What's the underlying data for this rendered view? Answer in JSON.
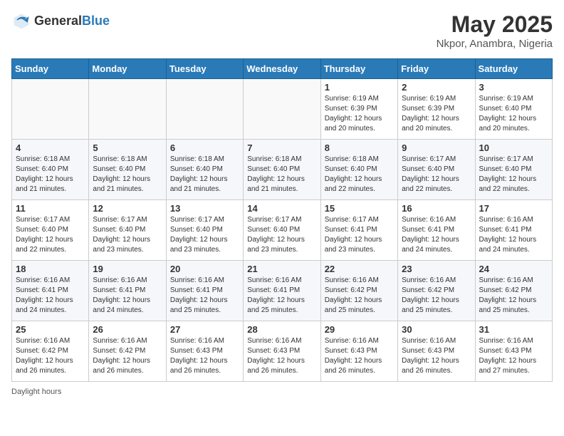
{
  "header": {
    "logo_general": "General",
    "logo_blue": "Blue",
    "title": "May 2025",
    "location": "Nkpor, Anambra, Nigeria"
  },
  "weekdays": [
    "Sunday",
    "Monday",
    "Tuesday",
    "Wednesday",
    "Thursday",
    "Friday",
    "Saturday"
  ],
  "weeks": [
    [
      {
        "day": "",
        "info": ""
      },
      {
        "day": "",
        "info": ""
      },
      {
        "day": "",
        "info": ""
      },
      {
        "day": "",
        "info": ""
      },
      {
        "day": "1",
        "info": "Sunrise: 6:19 AM\nSunset: 6:39 PM\nDaylight: 12 hours\nand 20 minutes."
      },
      {
        "day": "2",
        "info": "Sunrise: 6:19 AM\nSunset: 6:39 PM\nDaylight: 12 hours\nand 20 minutes."
      },
      {
        "day": "3",
        "info": "Sunrise: 6:19 AM\nSunset: 6:40 PM\nDaylight: 12 hours\nand 20 minutes."
      }
    ],
    [
      {
        "day": "4",
        "info": "Sunrise: 6:18 AM\nSunset: 6:40 PM\nDaylight: 12 hours\nand 21 minutes."
      },
      {
        "day": "5",
        "info": "Sunrise: 6:18 AM\nSunset: 6:40 PM\nDaylight: 12 hours\nand 21 minutes."
      },
      {
        "day": "6",
        "info": "Sunrise: 6:18 AM\nSunset: 6:40 PM\nDaylight: 12 hours\nand 21 minutes."
      },
      {
        "day": "7",
        "info": "Sunrise: 6:18 AM\nSunset: 6:40 PM\nDaylight: 12 hours\nand 21 minutes."
      },
      {
        "day": "8",
        "info": "Sunrise: 6:18 AM\nSunset: 6:40 PM\nDaylight: 12 hours\nand 22 minutes."
      },
      {
        "day": "9",
        "info": "Sunrise: 6:17 AM\nSunset: 6:40 PM\nDaylight: 12 hours\nand 22 minutes."
      },
      {
        "day": "10",
        "info": "Sunrise: 6:17 AM\nSunset: 6:40 PM\nDaylight: 12 hours\nand 22 minutes."
      }
    ],
    [
      {
        "day": "11",
        "info": "Sunrise: 6:17 AM\nSunset: 6:40 PM\nDaylight: 12 hours\nand 22 minutes."
      },
      {
        "day": "12",
        "info": "Sunrise: 6:17 AM\nSunset: 6:40 PM\nDaylight: 12 hours\nand 23 minutes."
      },
      {
        "day": "13",
        "info": "Sunrise: 6:17 AM\nSunset: 6:40 PM\nDaylight: 12 hours\nand 23 minutes."
      },
      {
        "day": "14",
        "info": "Sunrise: 6:17 AM\nSunset: 6:40 PM\nDaylight: 12 hours\nand 23 minutes."
      },
      {
        "day": "15",
        "info": "Sunrise: 6:17 AM\nSunset: 6:41 PM\nDaylight: 12 hours\nand 23 minutes."
      },
      {
        "day": "16",
        "info": "Sunrise: 6:16 AM\nSunset: 6:41 PM\nDaylight: 12 hours\nand 24 minutes."
      },
      {
        "day": "17",
        "info": "Sunrise: 6:16 AM\nSunset: 6:41 PM\nDaylight: 12 hours\nand 24 minutes."
      }
    ],
    [
      {
        "day": "18",
        "info": "Sunrise: 6:16 AM\nSunset: 6:41 PM\nDaylight: 12 hours\nand 24 minutes."
      },
      {
        "day": "19",
        "info": "Sunrise: 6:16 AM\nSunset: 6:41 PM\nDaylight: 12 hours\nand 24 minutes."
      },
      {
        "day": "20",
        "info": "Sunrise: 6:16 AM\nSunset: 6:41 PM\nDaylight: 12 hours\nand 25 minutes."
      },
      {
        "day": "21",
        "info": "Sunrise: 6:16 AM\nSunset: 6:41 PM\nDaylight: 12 hours\nand 25 minutes."
      },
      {
        "day": "22",
        "info": "Sunrise: 6:16 AM\nSunset: 6:42 PM\nDaylight: 12 hours\nand 25 minutes."
      },
      {
        "day": "23",
        "info": "Sunrise: 6:16 AM\nSunset: 6:42 PM\nDaylight: 12 hours\nand 25 minutes."
      },
      {
        "day": "24",
        "info": "Sunrise: 6:16 AM\nSunset: 6:42 PM\nDaylight: 12 hours\nand 25 minutes."
      }
    ],
    [
      {
        "day": "25",
        "info": "Sunrise: 6:16 AM\nSunset: 6:42 PM\nDaylight: 12 hours\nand 26 minutes."
      },
      {
        "day": "26",
        "info": "Sunrise: 6:16 AM\nSunset: 6:42 PM\nDaylight: 12 hours\nand 26 minutes."
      },
      {
        "day": "27",
        "info": "Sunrise: 6:16 AM\nSunset: 6:43 PM\nDaylight: 12 hours\nand 26 minutes."
      },
      {
        "day": "28",
        "info": "Sunrise: 6:16 AM\nSunset: 6:43 PM\nDaylight: 12 hours\nand 26 minutes."
      },
      {
        "day": "29",
        "info": "Sunrise: 6:16 AM\nSunset: 6:43 PM\nDaylight: 12 hours\nand 26 minutes."
      },
      {
        "day": "30",
        "info": "Sunrise: 6:16 AM\nSunset: 6:43 PM\nDaylight: 12 hours\nand 26 minutes."
      },
      {
        "day": "31",
        "info": "Sunrise: 6:16 AM\nSunset: 6:43 PM\nDaylight: 12 hours\nand 27 minutes."
      }
    ]
  ],
  "footer": "Daylight hours"
}
